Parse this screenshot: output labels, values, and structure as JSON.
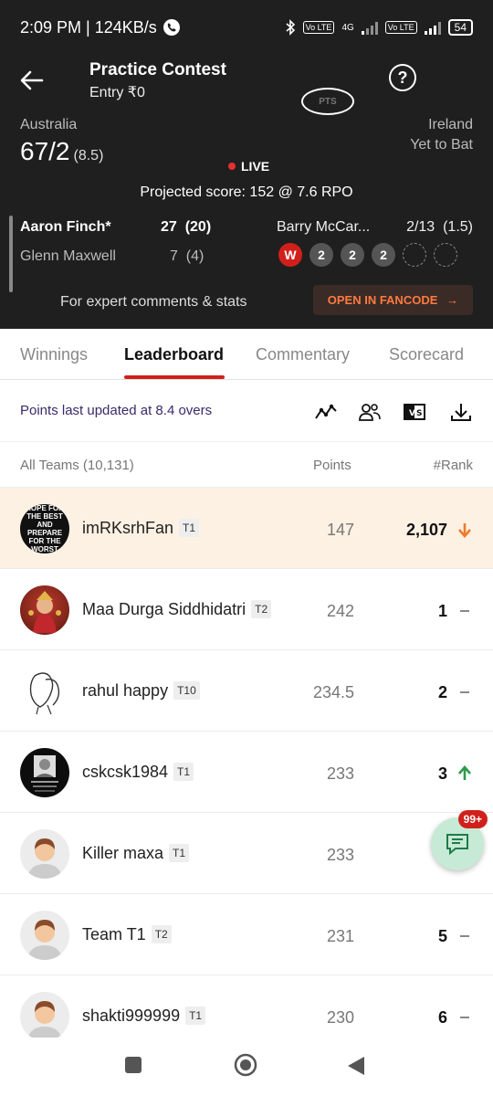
{
  "status": {
    "time_speed": "2:09 PM | 124KB/s",
    "battery": "54",
    "network": "4G",
    "volte": "Vo LTE"
  },
  "header": {
    "title": "Practice Contest",
    "entry": "Entry ₹0",
    "help_icon": "question-circle-icon",
    "pts_label": "PTS"
  },
  "match": {
    "batting_team": "Australia",
    "score": "67/2",
    "overs": "(8.5)",
    "live_label": "LIVE",
    "bowling_team": "Ireland",
    "bowling_status": "Yet to Bat",
    "projected": "Projected score: 152 @ 7.6 RPO",
    "batsman1_name": "Aaron Finch*",
    "batsman1_score": "27  (20)",
    "batsman2_name": "Glenn Maxwell",
    "batsman2_score": "7  (4)",
    "bowler_name": "Barry McCar...",
    "bowler_figures": "2/13  (1.5)",
    "balls": [
      "W",
      "2",
      "2",
      "2",
      "",
      ""
    ],
    "expert_text": "For expert comments & stats",
    "fancode_label": "OPEN IN FANCODE"
  },
  "tabs": [
    "Winnings",
    "Leaderboard",
    "Commentary",
    "Scorecard"
  ],
  "active_tab": "Leaderboard",
  "leaderboard": {
    "updated_text": "Points last updated at 8.4 overs",
    "col_teams": "All Teams (10,131)",
    "col_points": "Points",
    "col_rank": "#Rank",
    "rows": [
      {
        "name": "imRKsrhFan",
        "team": "T1",
        "points": "147",
        "rank": "2,107",
        "trend": "down"
      },
      {
        "name": "Maa Durga Siddhidatri",
        "team": "T2",
        "points": "242",
        "rank": "1",
        "trend": "same"
      },
      {
        "name": "rahul happy",
        "team": "T10",
        "points": "234.5",
        "rank": "2",
        "trend": "same"
      },
      {
        "name": "cskcsk1984",
        "team": "T1",
        "points": "233",
        "rank": "3",
        "trend": "up"
      },
      {
        "name": "Killer maxa",
        "team": "T1",
        "points": "233",
        "rank": "",
        "trend": "none"
      },
      {
        "name": "Team T1",
        "team": "T2",
        "points": "231",
        "rank": "5",
        "trend": "same"
      },
      {
        "name": "shakti999999",
        "team": "T1",
        "points": "230",
        "rank": "6",
        "trend": "same"
      }
    ]
  },
  "avatar1_text": "HOPE FOR THE BEST AND PREPARE FOR THE WORST",
  "chat_badge": "99+",
  "colors": {
    "dark_bg": "#1f1f1f",
    "accent_red": "#d1201b",
    "down_orange": "#f07a2a",
    "up_green": "#2e9a4a",
    "highlight_row": "#fdf1e3"
  }
}
